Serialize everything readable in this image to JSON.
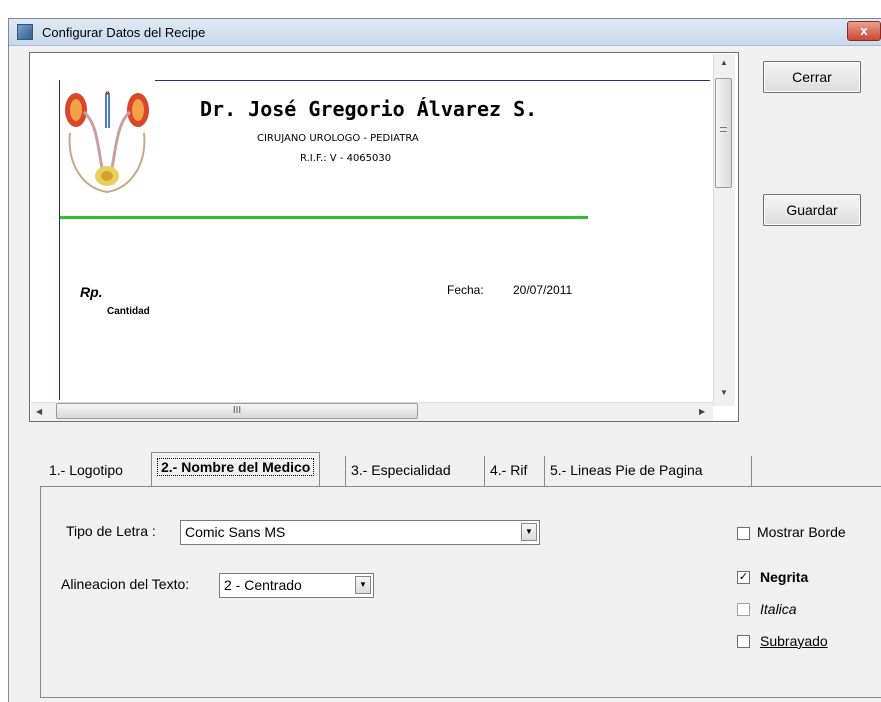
{
  "window": {
    "title": "Configurar Datos del Recipe",
    "close_glyph": "x"
  },
  "preview": {
    "doctor_name": "Dr. José Gregorio Álvarez S.",
    "specialty": "CIRUJANO UROLOGO - PEDIATRA",
    "rif": "R.I.F.: V - 4065030",
    "rp_label": "Rp.",
    "cantidad_label": "Cantidad",
    "fecha_label": "Fecha:",
    "fecha_value": "20/07/2011",
    "scroll_grip": "III",
    "accent_line_color": "#2fbf2f",
    "frame_line_color": "#1f2d87"
  },
  "buttons": {
    "cerrar": "Cerrar",
    "guardar": "Guardar"
  },
  "tabs": [
    {
      "label": "1.- Logotipo"
    },
    {
      "label": "2.- Nombre del Medico",
      "selected": true
    },
    {
      "label": "3.- Especialidad"
    },
    {
      "label": "4.- Rif"
    },
    {
      "label": "5.- Lineas Pie de Pagina"
    }
  ],
  "form": {
    "font_label": "Tipo de Letra :",
    "font_value": "Comic Sans MS",
    "align_label": "Alineacion del Texto:",
    "align_value": "2 - Centrado",
    "options": {
      "mostrar_borde": {
        "label": "Mostrar Borde",
        "checked": false
      },
      "negrita": {
        "label": "Negrita",
        "checked": true
      },
      "italica": {
        "label": "Italica",
        "checked": false
      },
      "subrayado": {
        "label": "Subrayado",
        "checked": false
      }
    }
  }
}
